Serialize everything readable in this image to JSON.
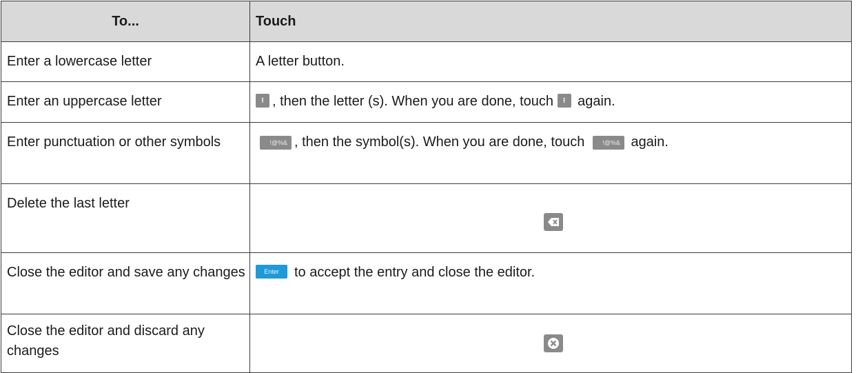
{
  "header": {
    "col1": "To...",
    "col2": "Touch"
  },
  "rows": [
    {
      "action": "Enter a lowercase letter",
      "touch": "A letter button."
    },
    {
      "action": "Enter an uppercase letter",
      "touch_a": ", then the letter (s). When you are done, touch ",
      "touch_b": " again.",
      "icon": "shift-icon"
    },
    {
      "action": "Enter punctuation or other symbols",
      "touch_a": ", then the symbol(s). When you are done, touch ",
      "touch_b": " again.",
      "icon": "symbols-key",
      "key_label": "!@%&"
    },
    {
      "action": "Delete the last letter",
      "icon": "backspace-icon"
    },
    {
      "action": "Close the editor and save any changes",
      "touch": "to accept the entry and close the editor.",
      "key_label": "Enter"
    },
    {
      "action": "Close the editor and discard any changes",
      "icon": "close-icon"
    }
  ]
}
